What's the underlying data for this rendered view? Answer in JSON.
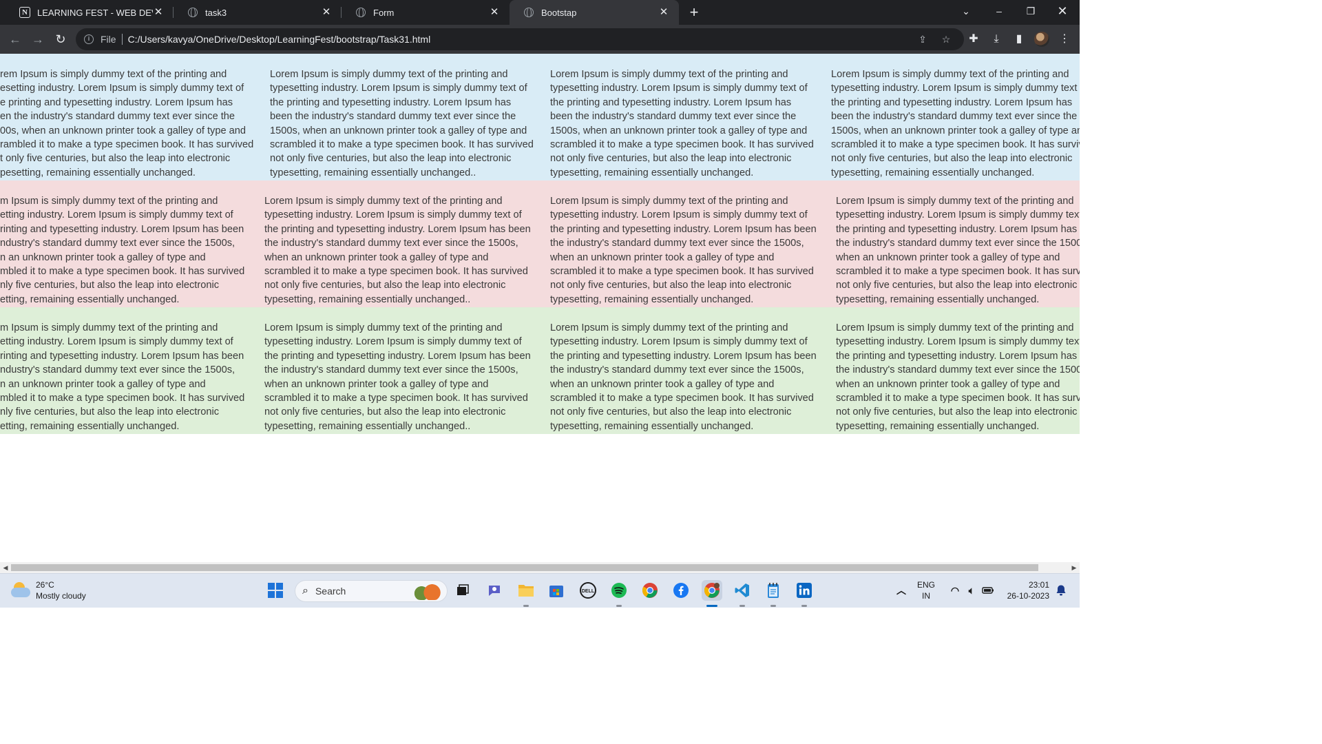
{
  "browser": {
    "tabs": [
      {
        "title": "LEARNING FEST - WEB DEVELOP",
        "icon": "notion-icon",
        "active": false
      },
      {
        "title": "task3",
        "icon": "globe-icon",
        "active": false
      },
      {
        "title": "Form",
        "icon": "globe-icon",
        "active": false
      },
      {
        "title": "Bootstap",
        "icon": "globe-icon",
        "active": true
      }
    ],
    "address": {
      "scheme": "File",
      "url": "C:/Users/kavya/OneDrive/Desktop/LearningFest/bootstrap/Task31.html"
    }
  },
  "page": {
    "rows": [
      {
        "color": "#d9ecf6",
        "cells": [
          [
            "rem Ipsum is simply dummy text of the printing and",
            "esetting industry. Lorem Ipsum is simply dummy text of",
            "e printing and typesetting industry. Lorem Ipsum has",
            "en the industry's standard dummy text ever since the",
            "00s, when an unknown printer took a galley of type and",
            "rambled it to make a type specimen book. It has survived",
            "t only five centuries, but also the leap into electronic",
            "pesetting, remaining essentially unchanged."
          ],
          [
            "Lorem Ipsum is simply dummy text of the printing and",
            "typesetting industry. Lorem Ipsum is simply dummy text of",
            "the printing and typesetting industry. Lorem Ipsum has",
            "been the industry's standard dummy text ever since the",
            "1500s, when an unknown printer took a galley of type and",
            "scrambled it to make a type specimen book. It has survived",
            "not only five centuries, but also the leap into electronic",
            "typesetting, remaining essentially unchanged.."
          ],
          [
            "Lorem Ipsum is simply dummy text of the printing and",
            "typesetting industry. Lorem Ipsum is simply dummy text of",
            "the printing and typesetting industry. Lorem Ipsum has",
            "been the industry's standard dummy text ever since the",
            "1500s, when an unknown printer took a galley of type and",
            "scrambled it to make a type specimen book. It has survived",
            "not only five centuries, but also the leap into electronic",
            "typesetting, remaining essentially unchanged."
          ],
          [
            "Lorem Ipsum is simply dummy text of the printing and",
            "typesetting industry. Lorem Ipsum is simply dummy text o",
            "the printing and typesetting industry. Lorem Ipsum has",
            "been the industry's standard dummy text ever since the",
            "1500s, when an unknown printer took a galley of type anc",
            "scrambled it to make a type specimen book. It has surviv",
            "not only five centuries, but also the leap into electronic",
            "typesetting, remaining essentially unchanged."
          ]
        ]
      },
      {
        "color": "#f4dcdd",
        "cells": [
          [
            "m Ipsum is simply dummy text of the printing and",
            "etting industry. Lorem Ipsum is simply dummy text of",
            "rinting and typesetting industry. Lorem Ipsum has been",
            "ndustry's standard dummy text ever since the 1500s,",
            "n an unknown printer took a galley of type and",
            "mbled it to make a type specimen book. It has survived",
            "nly five centuries, but also the leap into electronic",
            "etting, remaining essentially unchanged."
          ],
          [
            "Lorem Ipsum is simply dummy text of the printing and",
            "typesetting industry. Lorem Ipsum is simply dummy text of",
            "the printing and typesetting industry. Lorem Ipsum has been",
            "the industry's standard dummy text ever since the 1500s,",
            "when an unknown printer took a galley of type and",
            "scrambled it to make a type specimen book. It has survived",
            "not only five centuries, but also the leap into electronic",
            "typesetting, remaining essentially unchanged.."
          ],
          [
            "Lorem Ipsum is simply dummy text of the printing and",
            "typesetting industry. Lorem Ipsum is simply dummy text of",
            "the printing and typesetting industry. Lorem Ipsum has been",
            "the industry's standard dummy text ever since the 1500s,",
            "when an unknown printer took a galley of type and",
            "scrambled it to make a type specimen book. It has survived",
            "not only five centuries, but also the leap into electronic",
            "typesetting, remaining essentially unchanged."
          ],
          [
            "Lorem Ipsum is simply dummy text of the printing and",
            "typesetting industry. Lorem Ipsum is simply dummy text",
            "the printing and typesetting industry. Lorem Ipsum has b",
            "the industry's standard dummy text ever since the 1500s",
            "when an unknown printer took a galley of type and",
            "scrambled it to make a type specimen book. It has survi",
            "not only five centuries, but also the leap into electronic",
            "typesetting, remaining essentially unchanged."
          ]
        ]
      },
      {
        "color": "#deefd8",
        "cells": [
          [
            "m Ipsum is simply dummy text of the printing and",
            "etting industry. Lorem Ipsum is simply dummy text of",
            "rinting and typesetting industry. Lorem Ipsum has been",
            "ndustry's standard dummy text ever since the 1500s,",
            "n an unknown printer took a galley of type and",
            "mbled it to make a type specimen book. It has survived",
            "nly five centuries, but also the leap into electronic",
            "etting, remaining essentially unchanged."
          ],
          [
            "Lorem Ipsum is simply dummy text of the printing and",
            "typesetting industry. Lorem Ipsum is simply dummy text of",
            "the printing and typesetting industry. Lorem Ipsum has been",
            "the industry's standard dummy text ever since the 1500s,",
            "when an unknown printer took a galley of type and",
            "scrambled it to make a type specimen book. It has survived",
            "not only five centuries, but also the leap into electronic",
            "typesetting, remaining essentially unchanged.."
          ],
          [
            "Lorem Ipsum is simply dummy text of the printing and",
            "typesetting industry. Lorem Ipsum is simply dummy text of",
            "the printing and typesetting industry. Lorem Ipsum has been",
            "the industry's standard dummy text ever since the 1500s,",
            "when an unknown printer took a galley of type and",
            "scrambled it to make a type specimen book. It has survived",
            "not only five centuries, but also the leap into electronic",
            "typesetting, remaining essentially unchanged."
          ],
          [
            "Lorem Ipsum is simply dummy text of the printing and",
            "typesetting industry. Lorem Ipsum is simply dummy text",
            "the printing and typesetting industry. Lorem Ipsum has b",
            "the industry's standard dummy text ever since the 1500s",
            "when an unknown printer took a galley of type and",
            "scrambled it to make a type specimen book. It has survi",
            "not only five centuries, but also the leap into electronic",
            "typesetting, remaining essentially unchanged."
          ]
        ]
      }
    ]
  },
  "taskbar": {
    "weather": {
      "temp": "26°C",
      "condition": "Mostly cloudy"
    },
    "search_placeholder": "Search",
    "language": {
      "line1": "ENG",
      "line2": "IN"
    },
    "clock": {
      "time": "23:01",
      "date": "26-10-2023"
    }
  }
}
